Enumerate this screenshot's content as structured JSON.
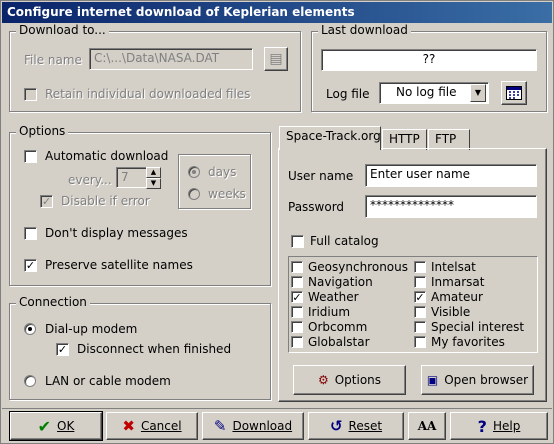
{
  "window": {
    "title": "Configure internet download of Keplerian elements"
  },
  "download_to": {
    "legend": "Download to...",
    "file_name_label": "File name",
    "file_name_value": "C:\\...\\Data\\NASA.DAT",
    "retain_label": "Retain individual downloaded files",
    "retain_checked": false
  },
  "last_download": {
    "legend": "Last download",
    "value": "??",
    "log_file_label": "Log file",
    "log_file_value": "No log file"
  },
  "options": {
    "legend": "Options",
    "automatic_download_label": "Automatic download",
    "automatic_download_checked": false,
    "every_label": "every...",
    "every_value": "7",
    "days_label": "days",
    "weeks_label": "weeks",
    "disable_if_error_label": "Disable if error",
    "dont_display_label": "Don't display messages",
    "preserve_names_label": "Preserve satellite names",
    "preserve_names_checked": true
  },
  "connection": {
    "legend": "Connection",
    "dialup_label": "Dial-up modem",
    "disconnect_label": "Disconnect when finished",
    "lan_label": "LAN or cable modem"
  },
  "tabs": [
    {
      "label": "Space-Track.org",
      "active": true
    },
    {
      "label": "HTTP",
      "active": false
    },
    {
      "label": "FTP",
      "active": false
    }
  ],
  "spacetrack": {
    "username_label": "User name",
    "username_value": "Enter user name",
    "password_label": "Password",
    "password_value": "**************",
    "full_catalog_label": "Full catalog",
    "catalog_left": [
      {
        "label": "Geosynchronous",
        "checked": false
      },
      {
        "label": "Navigation",
        "checked": false
      },
      {
        "label": "Weather",
        "checked": true
      },
      {
        "label": "Iridium",
        "checked": false
      },
      {
        "label": "Orbcomm",
        "checked": false
      },
      {
        "label": "Globalstar",
        "checked": false
      }
    ],
    "catalog_right": [
      {
        "label": "Intelsat",
        "checked": false
      },
      {
        "label": "Inmarsat",
        "checked": false
      },
      {
        "label": "Amateur",
        "checked": true
      },
      {
        "label": "Visible",
        "checked": false
      },
      {
        "label": "Special interest",
        "checked": false
      },
      {
        "label": "My favorites",
        "checked": false
      }
    ],
    "options_button": "Options",
    "open_browser_button": "Open browser"
  },
  "bottom": {
    "ok": "OK",
    "cancel": "Cancel",
    "download": "Download",
    "reset": "Reset",
    "help": "Help",
    "font_icon": "AA"
  },
  "colors": {
    "titlebar_start": "#0a246a",
    "titlebar_end": "#3a6ea5",
    "face": "#d4d0c8"
  }
}
